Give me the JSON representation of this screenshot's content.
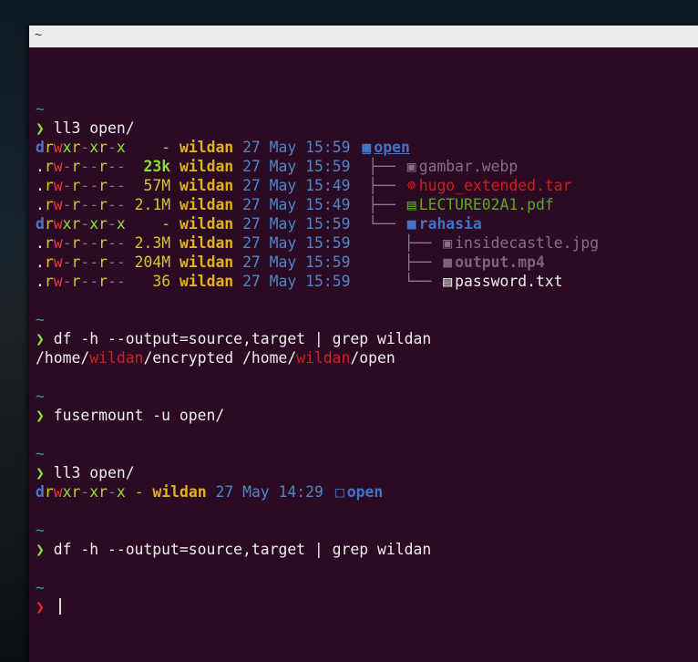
{
  "window": {
    "title": "~"
  },
  "prompt_symbol": "❯",
  "tilde": "~",
  "blocks": {
    "b1": {
      "command": "ll3 open/",
      "rows": [
        {
          "perm": [
            "d",
            "r",
            "w",
            "x",
            "r",
            "-",
            "x",
            "r",
            "-",
            "x"
          ],
          "size": "-",
          "user": "wildan",
          "date": "27 May 15:59",
          "tree": "",
          "icon": "folder-icon",
          "name": "open"
        },
        {
          "perm": [
            ".",
            "r",
            "w",
            "-",
            "r",
            "-",
            "-",
            "r",
            "-",
            "-"
          ],
          "size": "23k",
          "user": "wildan",
          "date": "27 May 15:59",
          "tree": "├──",
          "icon": "image-icon",
          "name": "gambar.webp"
        },
        {
          "perm": [
            ".",
            "r",
            "w",
            "-",
            "r",
            "-",
            "-",
            "r",
            "-",
            "-"
          ],
          "size": "57M",
          "user": "wildan",
          "date": "27 May 15:49",
          "tree": "├──",
          "icon": "archive-icon",
          "name": "hugo_extended.tar"
        },
        {
          "perm": [
            ".",
            "r",
            "w",
            "-",
            "r",
            "-",
            "-",
            "r",
            "-",
            "-"
          ],
          "size": "2.1M",
          "user": "wildan",
          "date": "27 May 15:49",
          "tree": "├──",
          "icon": "pdf-icon",
          "name": "LECTURE02A1.pdf"
        },
        {
          "perm": [
            "d",
            "r",
            "w",
            "x",
            "r",
            "-",
            "x",
            "r",
            "-",
            "x"
          ],
          "size": "-",
          "user": "wildan",
          "date": "27 May 15:59",
          "tree": "└──",
          "icon": "folder-icon",
          "name": "rahasia"
        },
        {
          "perm": [
            ".",
            "r",
            "w",
            "-",
            "r",
            "-",
            "-",
            "r",
            "-",
            "-"
          ],
          "size": "2.3M",
          "user": "wildan",
          "date": "27 May 15:59",
          "tree": "├──",
          "icon": "image-icon",
          "name": "insidecastle.jpg"
        },
        {
          "perm": [
            ".",
            "r",
            "w",
            "-",
            "r",
            "-",
            "-",
            "r",
            "-",
            "-"
          ],
          "size": "204M",
          "user": "wildan",
          "date": "27 May 15:59",
          "tree": "├──",
          "icon": "video-icon",
          "name": "output.mp4"
        },
        {
          "perm": [
            ".",
            "r",
            "w",
            "-",
            "r",
            "-",
            "-",
            "r",
            "-",
            "-"
          ],
          "size": "36",
          "user": "wildan",
          "date": "27 May 15:59",
          "tree": "└──",
          "icon": "file-icon",
          "name": "password.txt"
        }
      ]
    },
    "b2": {
      "command": "df -h --output=source,target | grep wildan",
      "out_1": "/home/",
      "out_2": "wildan",
      "out_3": "/encrypted /home/",
      "out_4": "wildan",
      "out_5": "/open"
    },
    "b3": {
      "command": "fusermount -u open/"
    },
    "b4": {
      "command": "ll3 open/",
      "row": {
        "perm": [
          "d",
          "r",
          "w",
          "x",
          "r",
          "-",
          "x",
          "r",
          "-",
          "x"
        ],
        "size": "-",
        "user": "wildan",
        "date": "27 May 14:29",
        "icon": "folder-open-icon",
        "name": "open"
      }
    },
    "b5": {
      "command": "df -h --output=source,target | grep wildan"
    }
  },
  "colors": {
    "background": "#2b0a24",
    "prompt": "#8ae234",
    "prompt_error": "#ef2929",
    "tilde": "#2aa198",
    "user": "#e0b21c",
    "date": "#4f86c6",
    "directory": "#3f74c7",
    "grep_highlight": "#d12020"
  }
}
